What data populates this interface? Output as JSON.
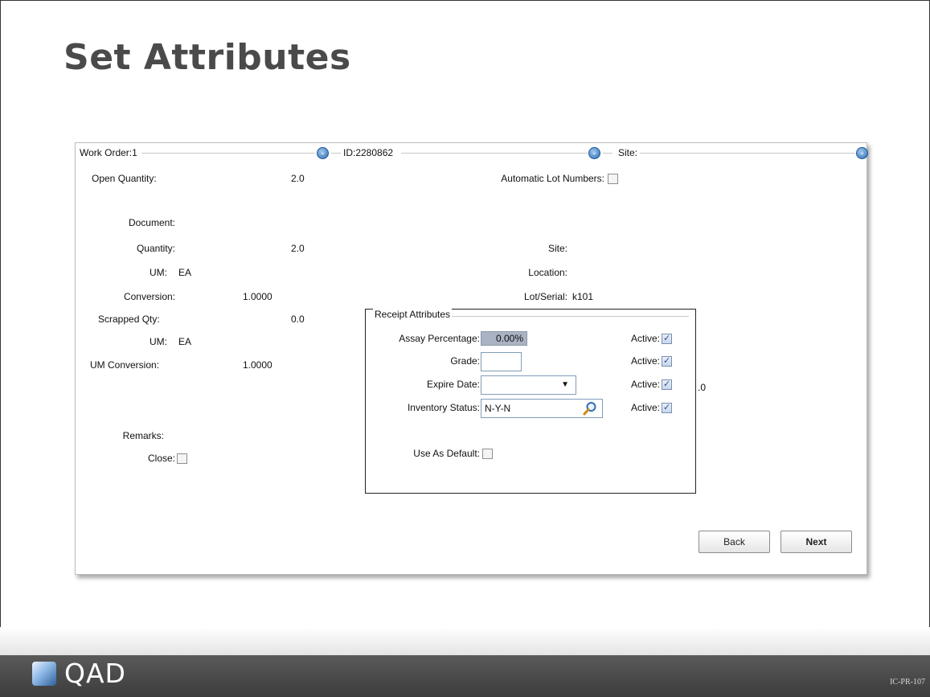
{
  "slide": {
    "title": "Set Attributes",
    "code": "IC-PR-107",
    "logo_text": "QAD"
  },
  "header": {
    "work_order_label": "Work Order:1",
    "id_label": "ID:2280862",
    "site_label": "Site:"
  },
  "left_panel": {
    "open_quantity_label": "Open Quantity:",
    "open_quantity_value": "2.0",
    "document_label": "Document:",
    "quantity_label": "Quantity:",
    "quantity_value": "2.0",
    "um_label": "UM:",
    "um_value": "EA",
    "conversion_label": "Conversion:",
    "conversion_value": "1.0000",
    "scrapped_qty_label": "Scrapped Qty:",
    "scrapped_qty_value": "0.0",
    "um2_label": "UM:",
    "um2_value": "EA",
    "um_conversion_label": "UM Conversion:",
    "um_conversion_value": "1.0000",
    "remarks_label": "Remarks:",
    "close_label": "Close:",
    "close_checked": false
  },
  "right_panel": {
    "auto_lot_label": "Automatic Lot Numbers:",
    "auto_lot_checked": false,
    "site_label": "Site:",
    "location_label": "Location:",
    "lot_serial_label": "Lot/Serial:",
    "lot_serial_value": "k101",
    "partial_value": ".0"
  },
  "receipt_attributes": {
    "title": "Receipt Attributes",
    "assay_label": "Assay Percentage:",
    "assay_value": "0.00%",
    "grade_label": "Grade:",
    "grade_value": "",
    "expire_label": "Expire Date:",
    "expire_value": "",
    "inventory_status_label": "Inventory Status:",
    "inventory_status_value": "N-Y-N",
    "active_label": "Active:",
    "use_as_default_label": "Use As Default:",
    "use_as_default_checked": false
  },
  "buttons": {
    "back": "Back",
    "next": "Next"
  },
  "colors": {
    "title_text": "#4a4a4a",
    "footer_bg": "#4a4a4a",
    "dropdown_accent": "#2e6db5"
  }
}
